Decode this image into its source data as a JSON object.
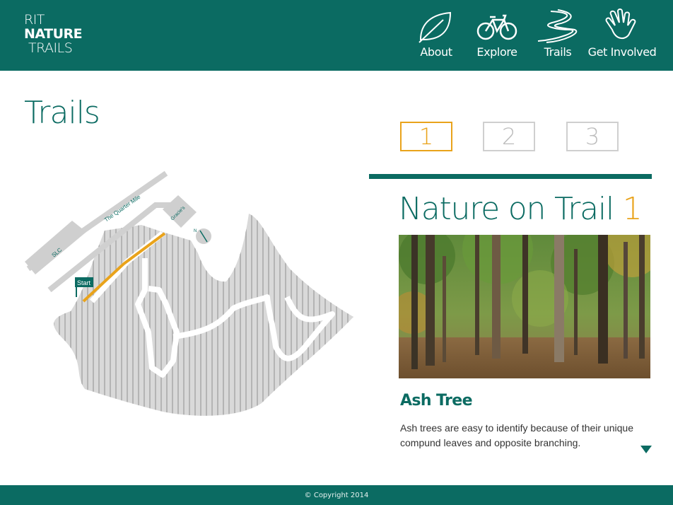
{
  "brand": {
    "line1": "RIT",
    "line2": "NATURE",
    "line3": "TRAILS"
  },
  "nav": {
    "items": [
      {
        "label": "About",
        "icon": "leaf-icon"
      },
      {
        "label": "Explore",
        "icon": "bicycle-icon"
      },
      {
        "label": "Trails",
        "icon": "winding-path-icon"
      },
      {
        "label": "Get Involved",
        "icon": "hand-icon"
      }
    ]
  },
  "page": {
    "title": "Trails"
  },
  "trail_tabs": {
    "tabs": [
      "1",
      "2",
      "3"
    ],
    "active": "1"
  },
  "section": {
    "title": "Nature on Trail ",
    "trail_number": "1"
  },
  "item": {
    "title": "Ash Tree",
    "description": "Ash trees are easy to identify because of their unique compund leaves and opposite branching."
  },
  "map": {
    "labels": {
      "road": "The Quarter Mile",
      "building_left": "SLC",
      "building_top": "Gracie's",
      "start": "Start",
      "north": "N"
    }
  },
  "colors": {
    "primary": "#0b6b62",
    "accent": "#e9a31b",
    "tab_border": "#cfcfcf"
  },
  "footer": {
    "copyright": "© Copyright 2014"
  }
}
